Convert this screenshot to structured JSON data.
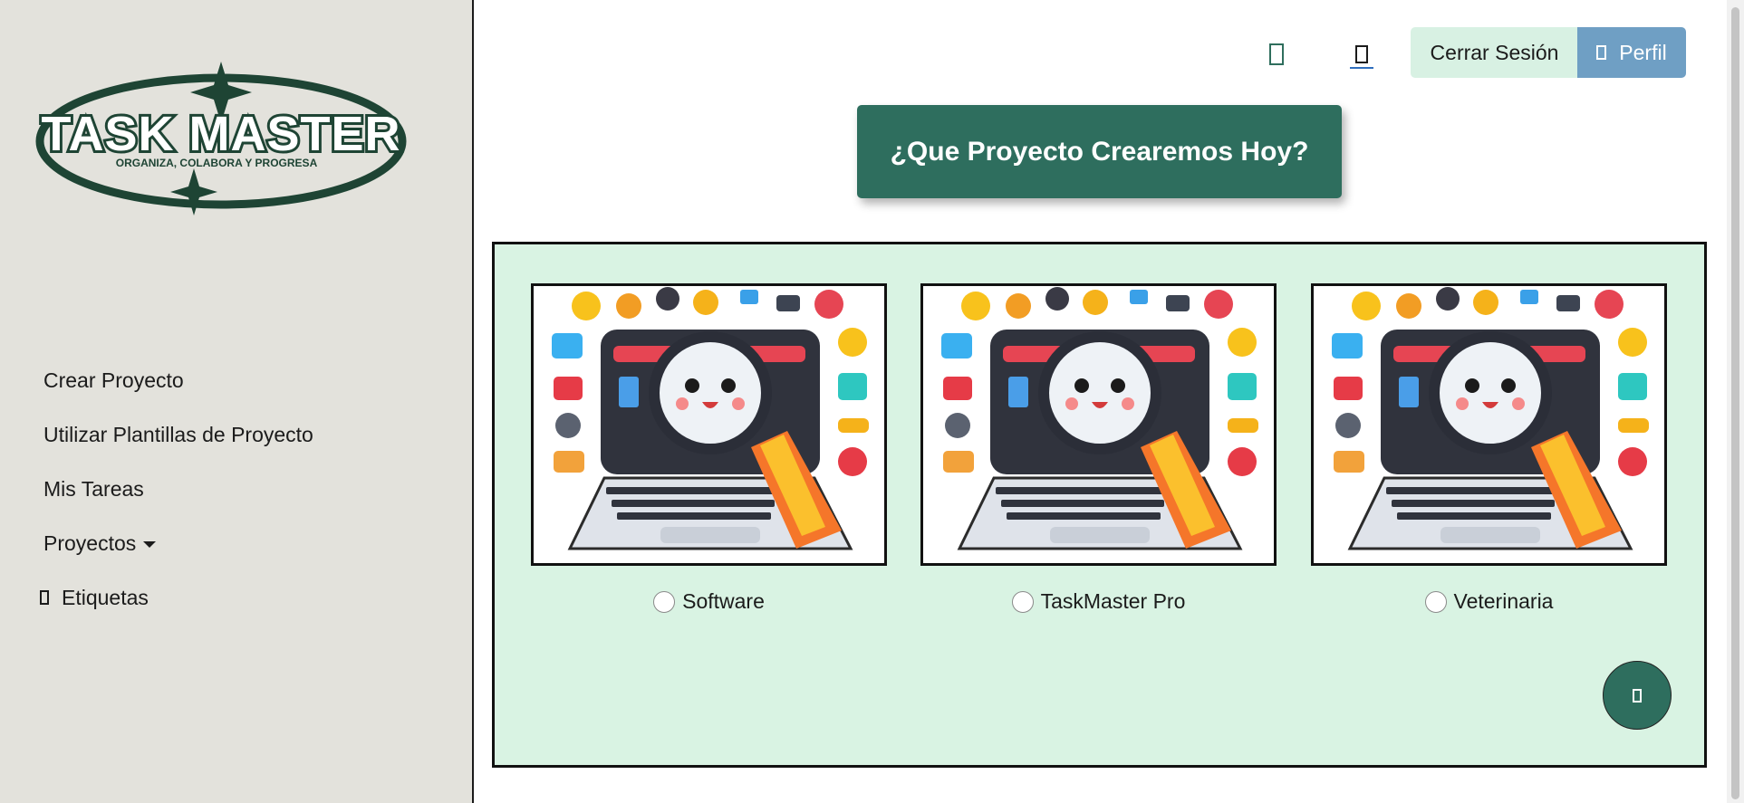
{
  "logo": {
    "title": "TASK MASTER",
    "tagline": "ORGANIZA, COLABORA Y PROGRESA"
  },
  "sidebar": {
    "items": [
      {
        "label": "Crear Proyecto"
      },
      {
        "label": "Utilizar Plantillas de Proyecto"
      },
      {
        "label": "Mis Tareas"
      },
      {
        "label": "Proyectos"
      },
      {
        "label": "Etiquetas"
      }
    ]
  },
  "header": {
    "icons": [
      "app-icon",
      "document-icon"
    ],
    "logout_label": "Cerrar Sesión",
    "profile_label": "Perfil"
  },
  "hero": {
    "title": "¿Que Proyecto Crearemos Hoy?"
  },
  "templates": [
    {
      "label": "Software"
    },
    {
      "label": "TaskMaster Pro"
    },
    {
      "label": "Veterinaria"
    }
  ],
  "colors": {
    "sidebar_bg": "#e3e2dc",
    "primary": "#2e6e5e",
    "panel_bg": "#d9f3e3",
    "logout_bg": "#d8f1e3",
    "profile_bg": "#6f9fc4"
  }
}
